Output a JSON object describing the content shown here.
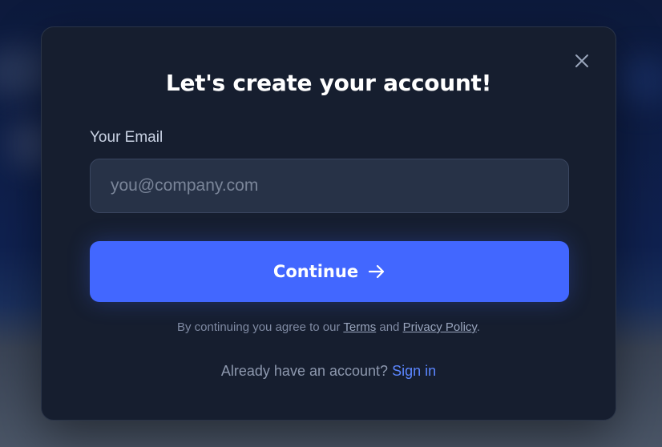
{
  "modal": {
    "title": "Let's create your account!",
    "close_icon": "close-icon",
    "email": {
      "label": "Your Email",
      "value": "",
      "placeholder": "you@company.com"
    },
    "continue_button": {
      "label": "Continue",
      "icon": "arrow-right-icon"
    },
    "terms": {
      "prefix": "By continuing you agree to our",
      "terms_link": "Terms",
      "conjunction": "and",
      "privacy_link": "Privacy Policy",
      "suffix": "."
    },
    "signin": {
      "prompt": "Already have an account?",
      "link": "Sign in"
    }
  },
  "colors": {
    "accent": "#4267ff",
    "link": "#5b86ff",
    "modal_bg": "#161e2f",
    "input_bg": "#273247"
  }
}
